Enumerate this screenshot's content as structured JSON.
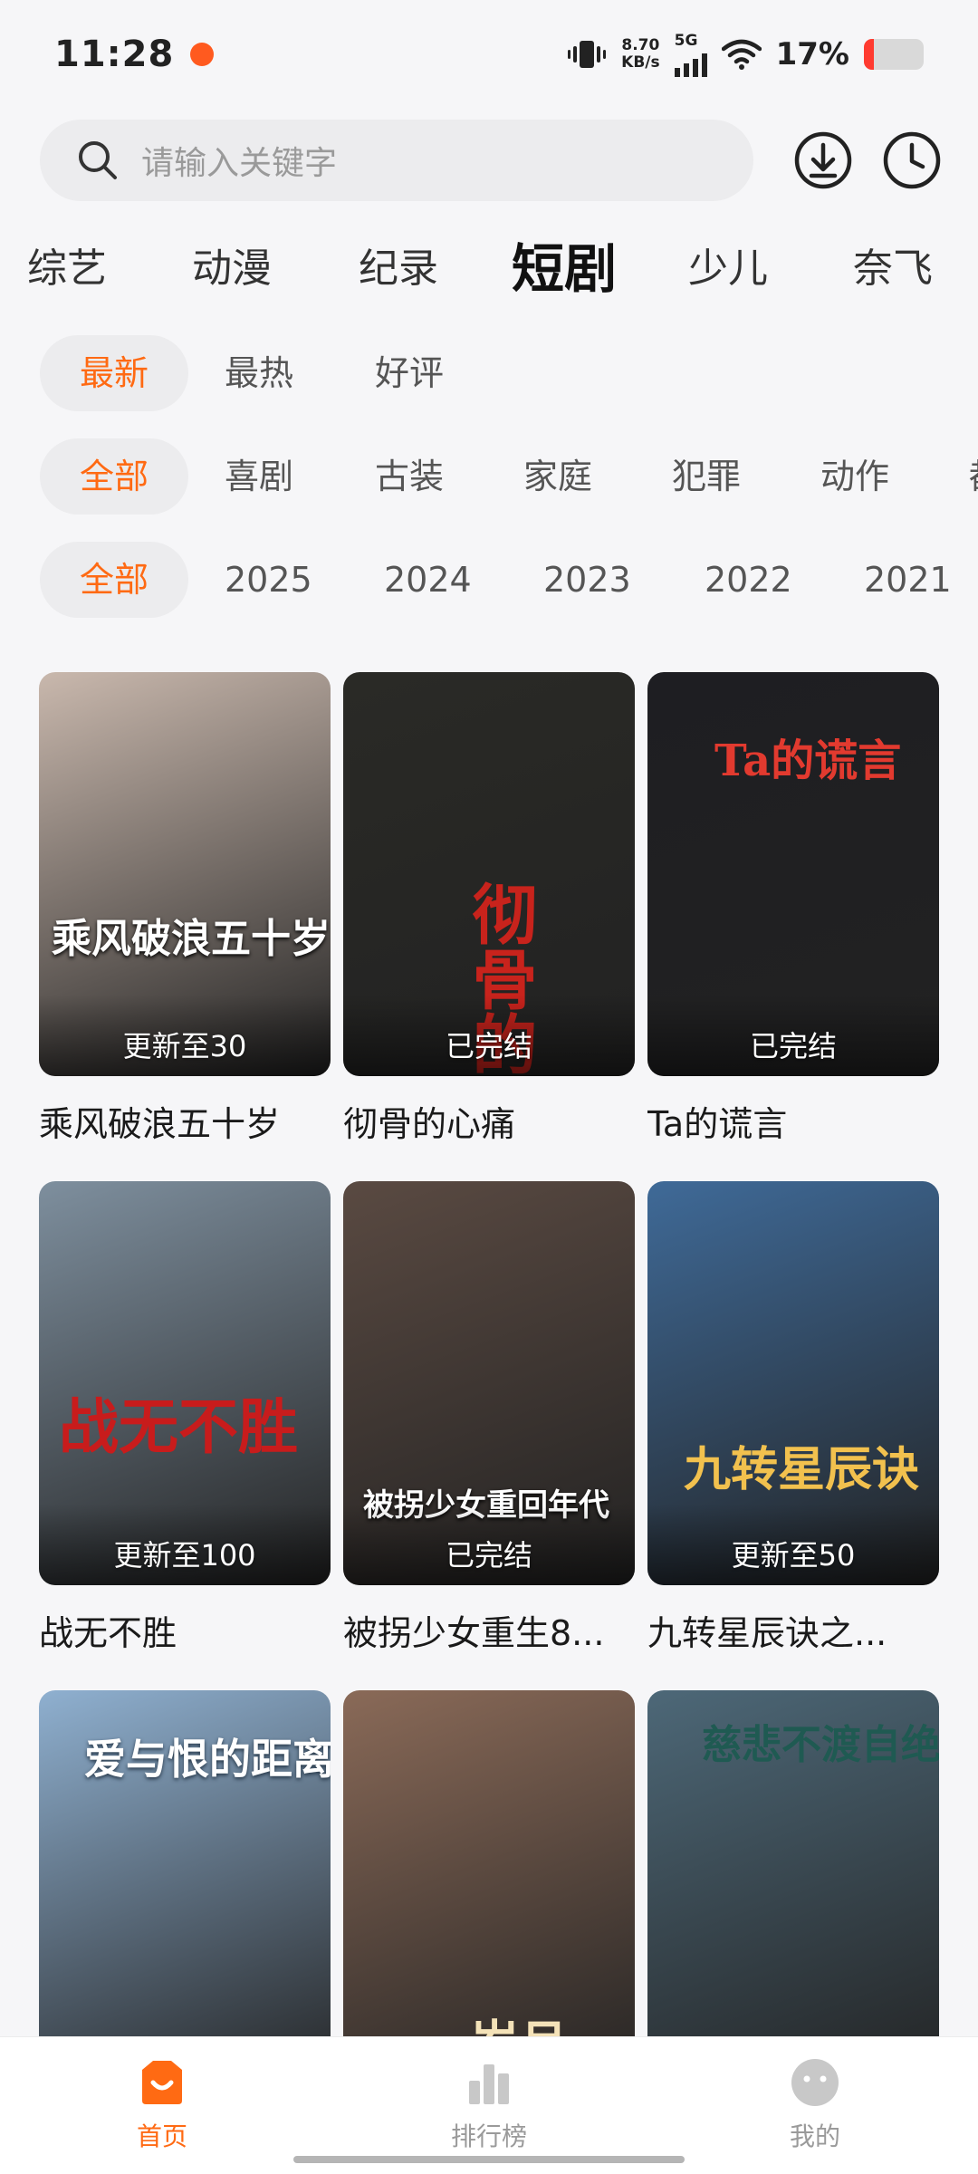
{
  "status": {
    "time": "11:28",
    "speed_top": "8.70",
    "speed_bottom": "KB/s",
    "network": "5G",
    "battery": "17%",
    "battery_level": 0.17
  },
  "search": {
    "placeholder": "请输入关键字"
  },
  "categories": [
    "综艺",
    "动漫",
    "纪录",
    "短剧",
    "少儿",
    "奈飞"
  ],
  "active_category": "短剧",
  "sort_filters": [
    "最新",
    "最热",
    "好评"
  ],
  "genre_filters": [
    "全部",
    "喜剧",
    "古装",
    "家庭",
    "犯罪",
    "动作",
    "都"
  ],
  "year_filters": [
    "全部",
    "2025",
    "2024",
    "2023",
    "2022",
    "2021"
  ],
  "items": [
    {
      "title": "乘风破浪五十岁",
      "badge": "更新至30",
      "poster_text": "乘风破浪五十岁",
      "color": "#c9b8ad"
    },
    {
      "title": "彻骨的心痛",
      "badge": "已完结",
      "poster_text": "彻骨的",
      "color": "#2a2a26"
    },
    {
      "title": "Ta的谎言",
      "badge": "已完结",
      "poster_text": "Ta的谎言",
      "color": "#1e1e22"
    },
    {
      "title": "战无不胜",
      "badge": "更新至100",
      "poster_text": "战无不胜",
      "color": "#7e8f9e"
    },
    {
      "title": "被拐少女重生8...",
      "badge": "已完结",
      "poster_text": "被拐少女重回年代",
      "color": "#5a4a42"
    },
    {
      "title": "九转星辰诀之...",
      "badge": "更新至50",
      "poster_text": "九转星辰诀",
      "color": "#3f6a98"
    },
    {
      "title": "",
      "badge": "",
      "poster_text": "爱与恨的距离",
      "color": "#8fb0d0"
    },
    {
      "title": "",
      "badge": "",
      "poster_text": "岁月",
      "color": "#8a6a58"
    },
    {
      "title": "",
      "badge": "",
      "poster_text": "慈悲不渡自绝人",
      "color": "#4d6878"
    }
  ],
  "nav": [
    {
      "label": "首页",
      "icon": "home-icon",
      "active": true
    },
    {
      "label": "排行榜",
      "icon": "ranking-icon",
      "active": false
    },
    {
      "label": "我的",
      "icon": "profile-icon",
      "active": false
    }
  ],
  "colors": {
    "accent": "#ff6a13",
    "battery_low": "#ff3b30"
  }
}
